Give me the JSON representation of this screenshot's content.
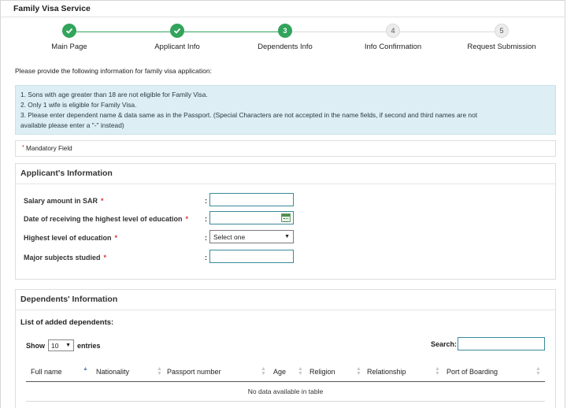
{
  "header": {
    "title": "Family Visa Service"
  },
  "stepper": {
    "steps": [
      {
        "number": "",
        "label": "Main Page",
        "state": "done"
      },
      {
        "number": "",
        "label": "Applicant Info",
        "state": "done"
      },
      {
        "number": "3",
        "label": "Dependents Info",
        "state": "active"
      },
      {
        "number": "4",
        "label": "Info Confirmation",
        "state": "pending"
      },
      {
        "number": "5",
        "label": "Request Submission",
        "state": "pending"
      }
    ],
    "colors": {
      "done": "#32a45c",
      "pending": "#dadada"
    }
  },
  "intro": "Please provide the following information for family visa application:",
  "notes": [
    "1. Sons with age greater than 18 are not eligible for Family Visa.",
    "2. Only 1 wife is eligible for Family Visa.",
    "3. Please enter dependent name & data same as in the Passport. (Special Characters are not accepted in the name fields, if second and third names are not",
    "available please enter a \"-\" instead)"
  ],
  "mandatory": {
    "star": "*",
    "text": "Mandatory Field"
  },
  "applicant": {
    "title": "Applicant's Information",
    "fields": [
      {
        "label": "Salary amount in SAR",
        "req": "*",
        "colon": ":",
        "value": ""
      },
      {
        "label": "Date of receiving the highest level of education",
        "req": "*",
        "colon": ":",
        "value": ""
      },
      {
        "label": "Highest level of education",
        "req": "*",
        "colon": ":",
        "value": "Select one"
      },
      {
        "label": "Major subjects studied",
        "req": "*",
        "colon": ":",
        "value": ""
      }
    ]
  },
  "dependents": {
    "title": "Dependents' Information",
    "list_label": "List of added dependents:",
    "show_label": "Show",
    "page_length": "10",
    "entries_label": "entries",
    "search_label": "Search:",
    "columns": [
      "Full name",
      "Nationality",
      "Passport number",
      "Age",
      "Religion",
      "Relationship",
      "Port of Boarding"
    ],
    "empty_text": "No data available in table"
  }
}
